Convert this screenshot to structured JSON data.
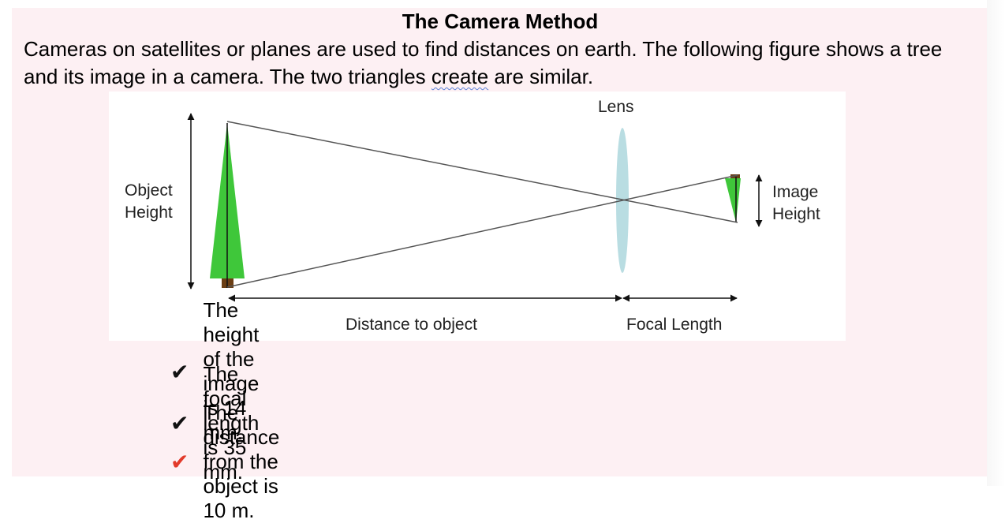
{
  "title": "The Camera Method",
  "intro": {
    "part1": "Cameras on satellites or planes are used to find distances on earth.  The following figure shows a tree and its image in a camera. The two triangles ",
    "flagged_word": "create",
    "part2": " are similar."
  },
  "figure": {
    "lens_label": "Lens",
    "object_height_label": [
      "Object",
      "Height"
    ],
    "image_height_label": [
      "Image",
      "Height"
    ],
    "distance_label": "Distance to object",
    "focal_length_label": "Focal Length",
    "colors": {
      "tree": "#3fc73a",
      "trunk": "#6b3e15",
      "lens": "#b9dde2"
    }
  },
  "facts": [
    {
      "icon": "check-icon",
      "text": "The height of the image is 14 mm.",
      "color": "#111111"
    },
    {
      "icon": "check-icon",
      "text": "The focal length is 35 mm.",
      "color": "#111111"
    },
    {
      "icon": "check-icon",
      "text": "The distance from the object is 10 m.",
      "color": "#e23a2a"
    }
  ]
}
